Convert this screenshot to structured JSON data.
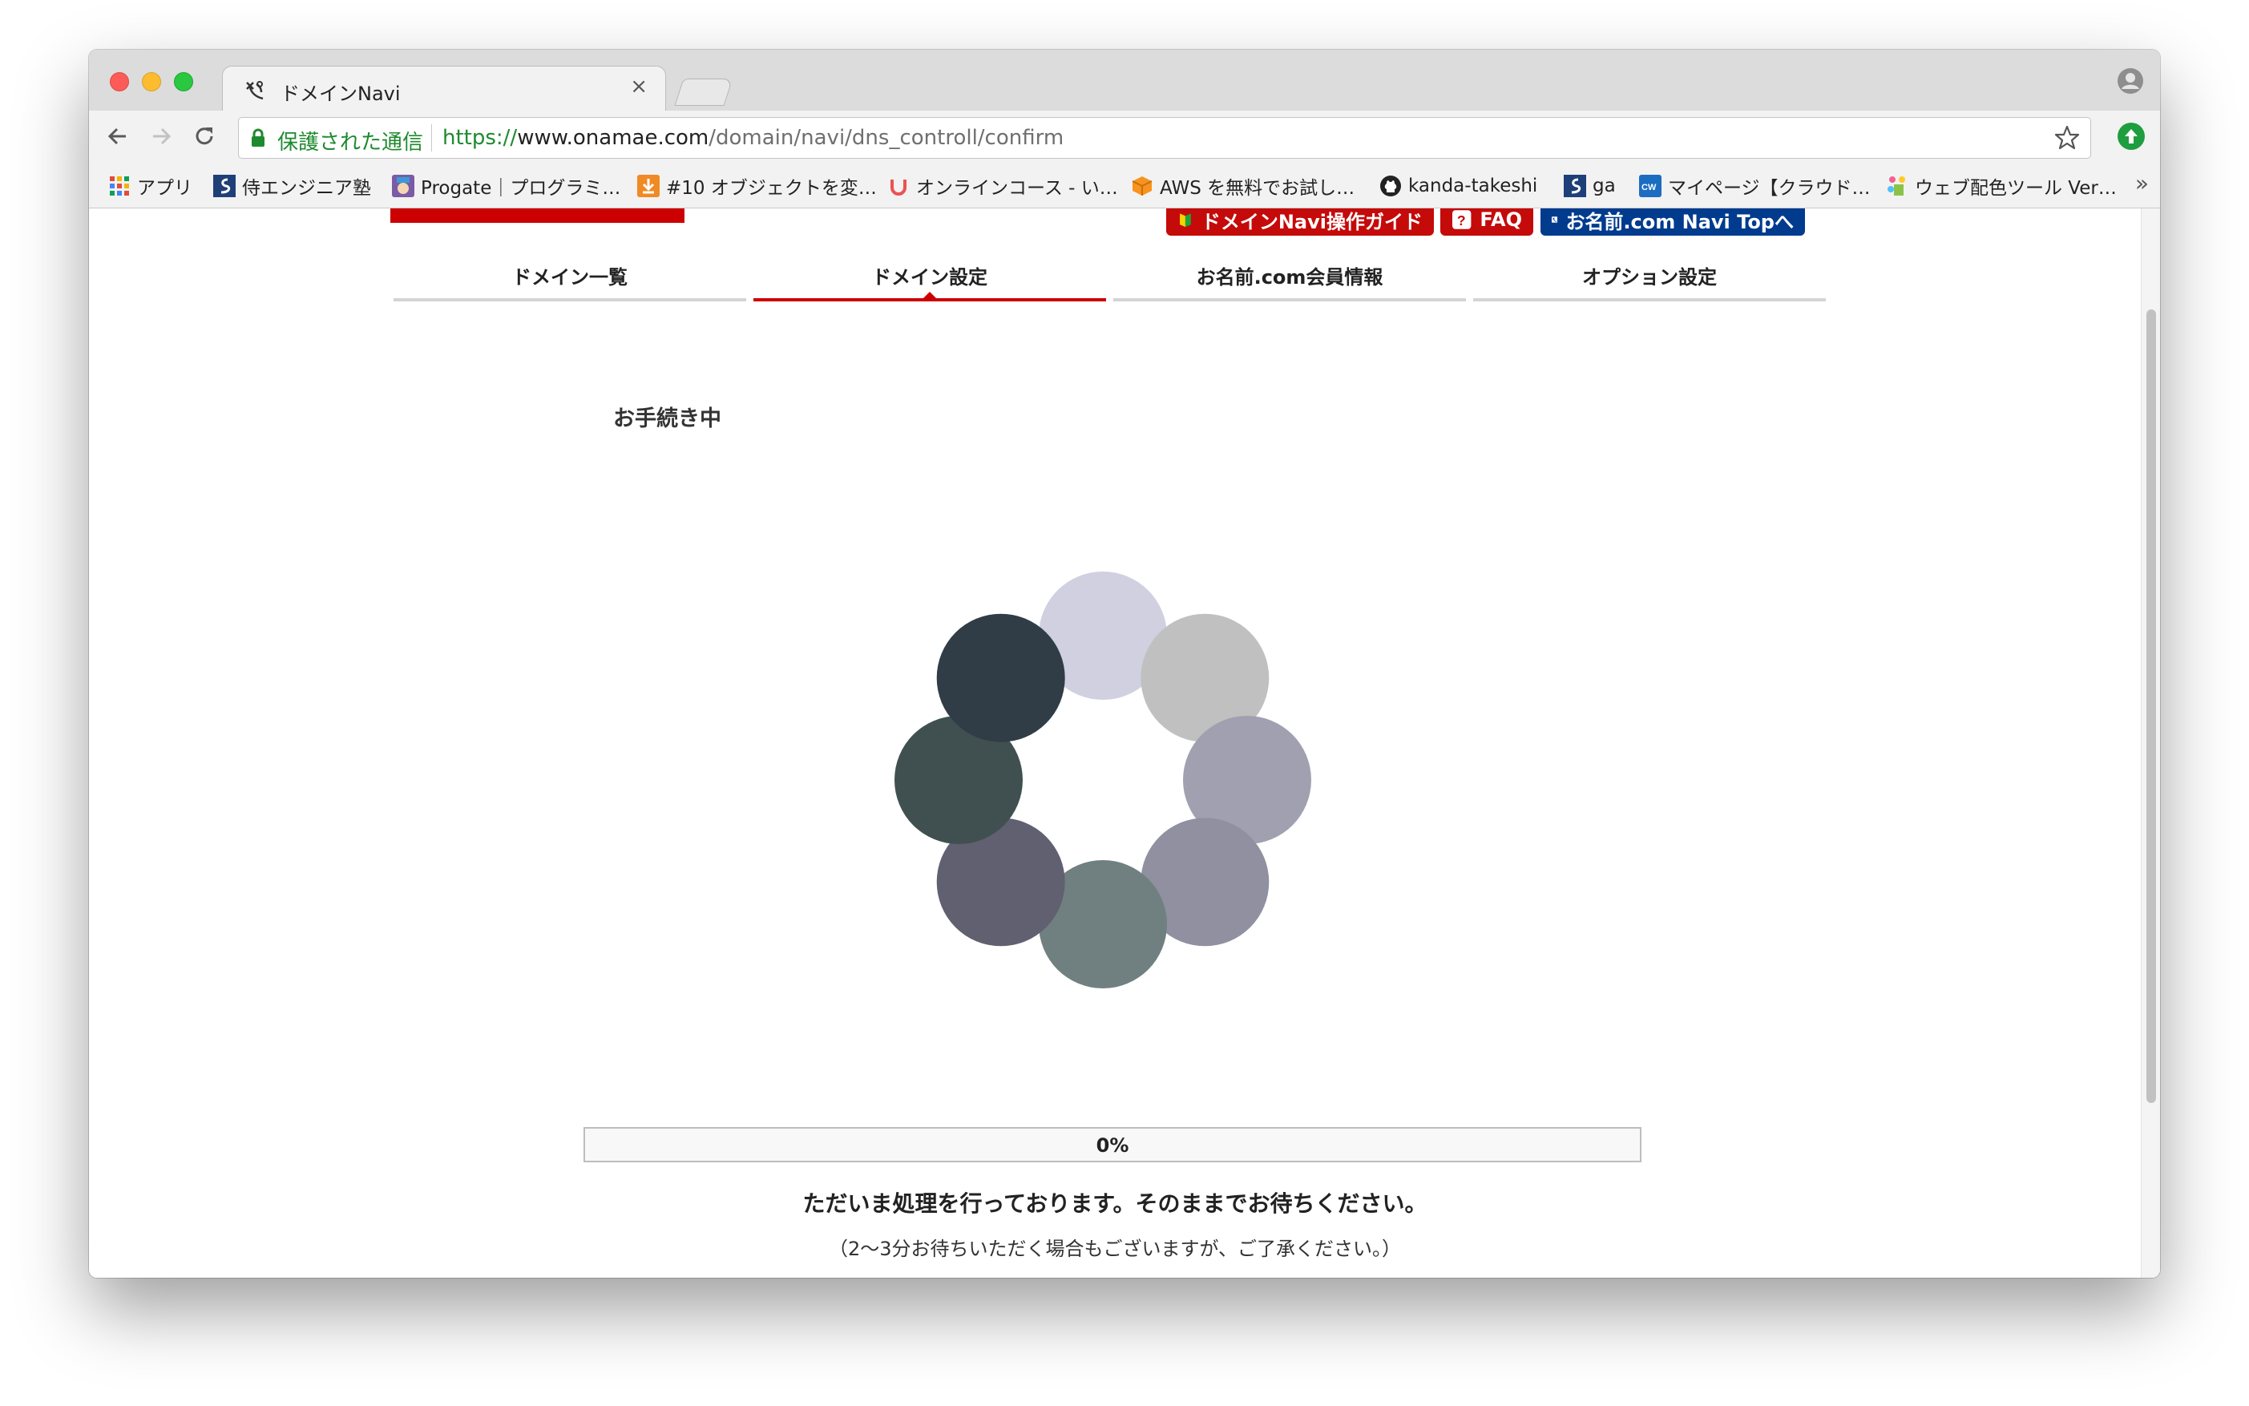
{
  "browser": {
    "tab_title": "ドメインNavi",
    "tab_close": "×",
    "security_label": "保護された通信",
    "url_scheme": "https://",
    "url_host": "www.onamae.com",
    "url_path": "/domain/navi/dns_controll/confirm",
    "bookmarks": [
      {
        "label": "アプリ",
        "icon": "apps-grid-icon",
        "color": "#e34b3c"
      },
      {
        "label": "侍エンジニア塾",
        "icon": "samurai-icon",
        "color": "#1f3f78"
      },
      {
        "label": "Progate｜プログラミ…",
        "icon": "progate-icon",
        "color": "#7b5aa6"
      },
      {
        "label": "#10 オブジェクトを変…",
        "icon": "download-icon",
        "color": "#f08a24"
      },
      {
        "label": "オンラインコース - い…",
        "icon": "udemy-icon",
        "color": "#ec5252"
      },
      {
        "label": "AWS を無料でお試し…",
        "icon": "aws-cube-icon",
        "color": "#f7931e"
      },
      {
        "label": "kanda-takeshi",
        "icon": "github-icon",
        "color": "#222222"
      },
      {
        "label": "ga",
        "icon": "samurai-icon",
        "color": "#1f3f78"
      },
      {
        "label": "マイページ【クラウド…",
        "icon": "crowdworks-icon",
        "color": "#1b6dc1"
      },
      {
        "label": "ウェブ配色ツール Ver…",
        "icon": "palette-icon",
        "color": "#8bc34a"
      }
    ],
    "bookmarks_more": "»"
  },
  "header": {
    "guide_button": "ドメインNavi操作ガイド",
    "faq_button": "FAQ",
    "top_button": "お名前.com Navi Topへ"
  },
  "nav_tabs": [
    {
      "label": "ドメイン一覧",
      "active": false
    },
    {
      "label": "ドメイン設定",
      "active": true
    },
    {
      "label": "お名前.com会員情報",
      "active": false
    },
    {
      "label": "オプション設定",
      "active": false
    }
  ],
  "main": {
    "title": "お手続き中",
    "progress_value": 0,
    "progress_text": "0%",
    "message": "ただいま処理を行っております。そのままでお待ちください。",
    "note": "（2〜3分お待ちいただく場合もございますが、ご了承ください。）"
  },
  "spinner": {
    "dots": [
      {
        "color": "#d0d0e0"
      },
      {
        "color": "#c0c0c0"
      },
      {
        "color": "#a0a0b0"
      },
      {
        "color": "#9090a0"
      },
      {
        "color": "#708080"
      },
      {
        "color": "#606070"
      },
      {
        "color": "#405050"
      },
      {
        "color": "#303d47"
      }
    ]
  },
  "colors": {
    "accent_red": "#cc0000",
    "navy": "#003b8e",
    "secure_green": "#1e8a2e"
  }
}
